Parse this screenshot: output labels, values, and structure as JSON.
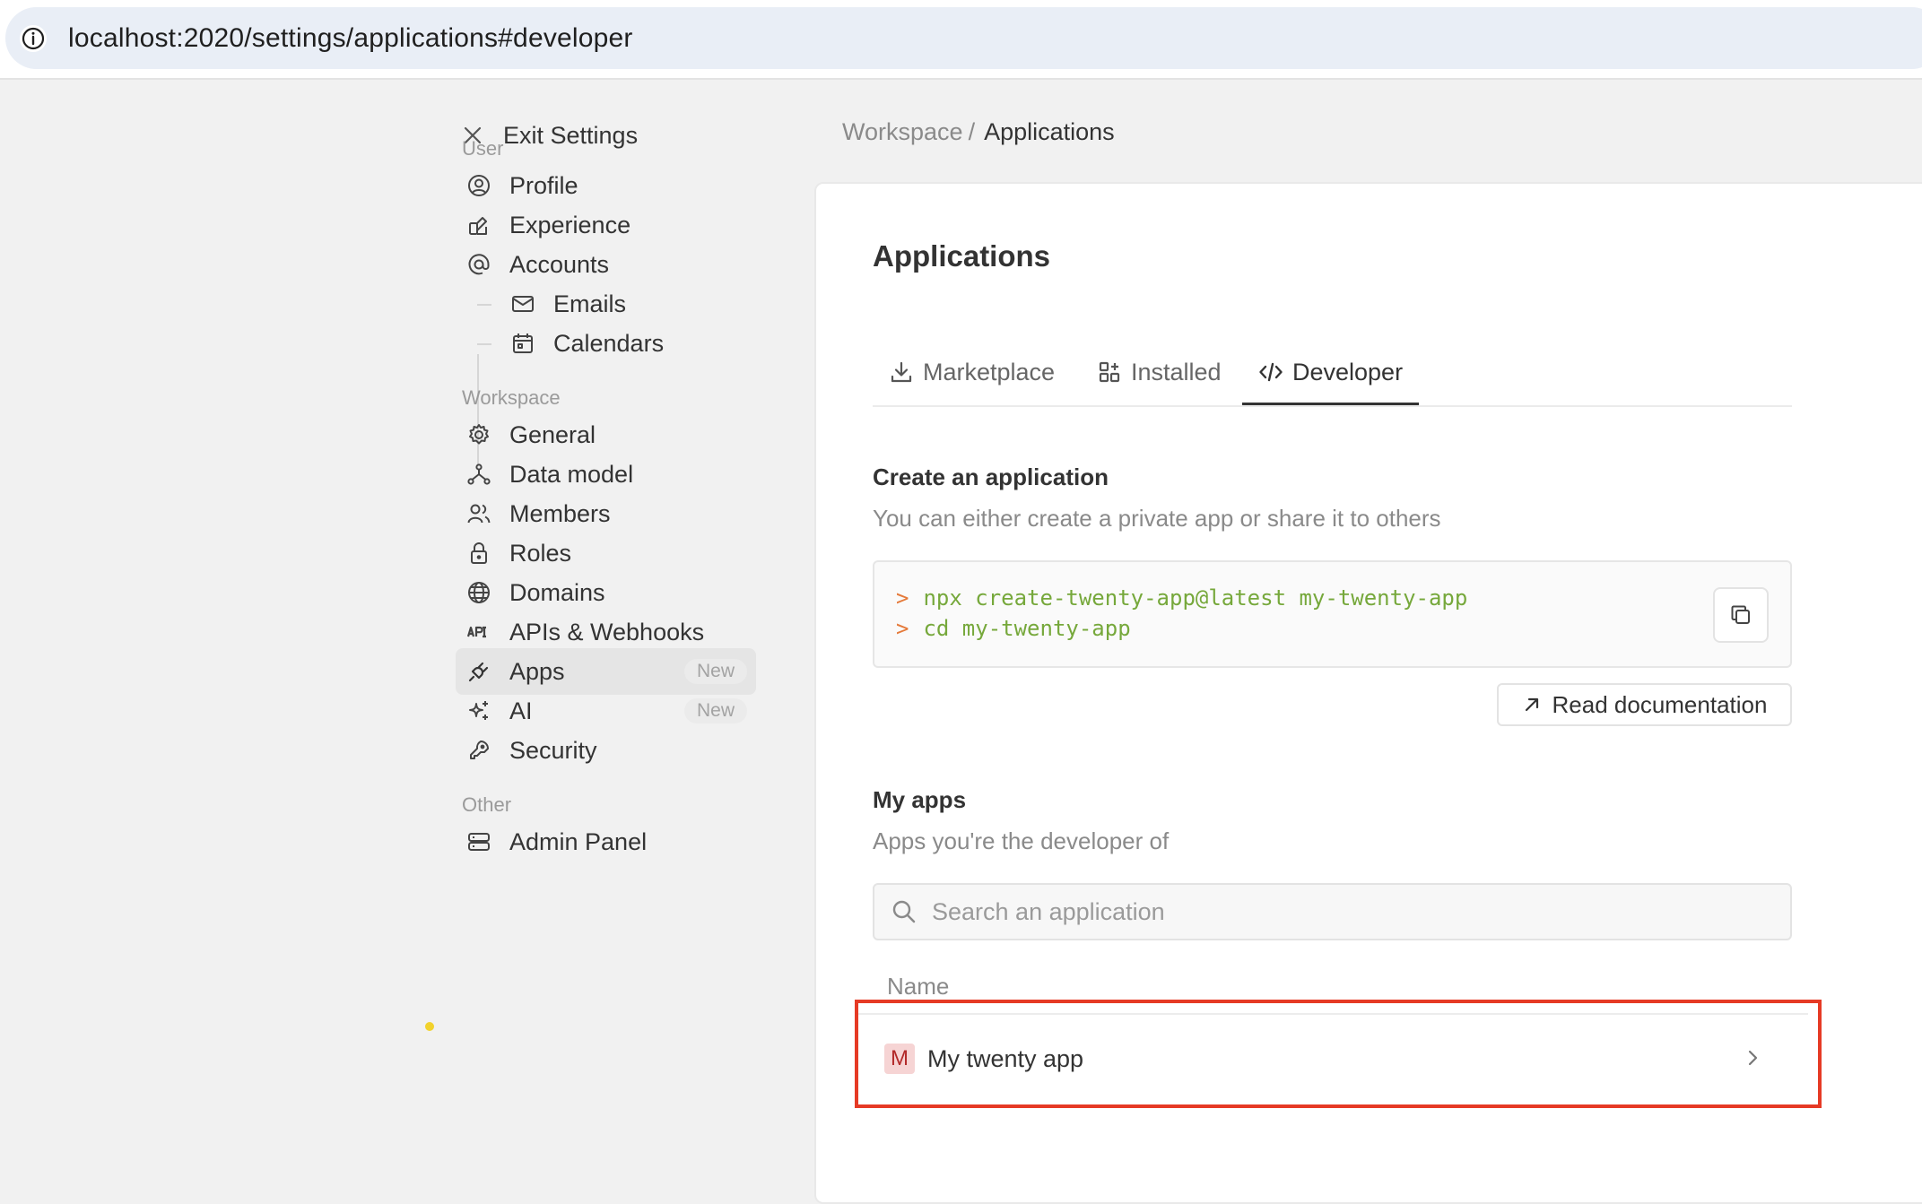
{
  "browser": {
    "url": "localhost:2020/settings/applications#developer"
  },
  "sidebar": {
    "exit_label": "Exit Settings",
    "sections": {
      "user": "User",
      "workspace": "Workspace",
      "other": "Other"
    },
    "user_items": [
      {
        "label": "Profile",
        "icon": "user-circle-icon"
      },
      {
        "label": "Experience",
        "icon": "color-swatch-icon"
      },
      {
        "label": "Accounts",
        "icon": "at-icon"
      },
      {
        "label": "Emails",
        "icon": "mail-icon"
      },
      {
        "label": "Calendars",
        "icon": "calendar-icon"
      }
    ],
    "workspace_items": [
      {
        "label": "General",
        "icon": "gear-icon"
      },
      {
        "label": "Data model",
        "icon": "hierarchy-icon"
      },
      {
        "label": "Members",
        "icon": "users-icon"
      },
      {
        "label": "Roles",
        "icon": "lock-icon"
      },
      {
        "label": "Domains",
        "icon": "globe-icon"
      },
      {
        "label": "APIs & Webhooks",
        "icon": "api-icon"
      },
      {
        "label": "Apps",
        "icon": "plug-icon",
        "badge": "New",
        "active": true
      },
      {
        "label": "AI",
        "icon": "sparkles-icon",
        "badge": "New"
      },
      {
        "label": "Security",
        "icon": "key-icon"
      }
    ],
    "other_items": [
      {
        "label": "Admin Panel",
        "icon": "server-icon"
      }
    ]
  },
  "breadcrumb": {
    "parent": "Workspace",
    "separator": "/",
    "current": "Applications"
  },
  "main": {
    "title": "Applications",
    "tabs": [
      {
        "label": "Marketplace",
        "icon": "download-icon"
      },
      {
        "label": "Installed",
        "icon": "apps-grid-icon"
      },
      {
        "label": "Developer",
        "icon": "code-icon",
        "active": true
      }
    ],
    "create": {
      "title": "Create an application",
      "description": "You can either create a private app or share it to others",
      "commands": [
        {
          "prompt": ">",
          "command": "npx create-twenty-app@latest my-twenty-app"
        },
        {
          "prompt": ">",
          "command": "cd my-twenty-app"
        }
      ],
      "read_docs_label": "Read documentation"
    },
    "my_apps": {
      "title": "My apps",
      "description": "Apps you're the developer of",
      "search_placeholder": "Search an application",
      "search_value": "",
      "column_name": "Name",
      "rows": [
        {
          "avatar_letter": "M",
          "name": "My twenty app"
        }
      ]
    }
  },
  "colors": {
    "highlight": "#e63a25",
    "command_green": "#76a83b",
    "prompt_orange": "#e57a3a",
    "notice_dot": "#f2d22c"
  }
}
